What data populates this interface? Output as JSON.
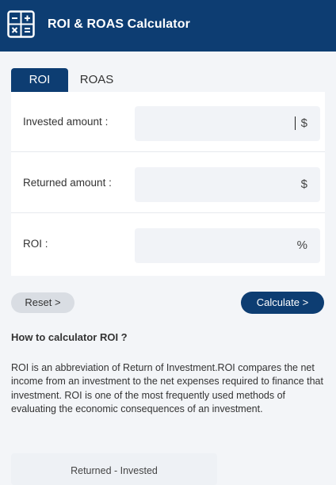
{
  "header": {
    "title": "ROI & ROAS Calculator",
    "logo_icon": "calculator-icon",
    "bg_color": "#0d3d72"
  },
  "tabs": [
    {
      "label": "ROI",
      "active": true
    },
    {
      "label": "ROAS",
      "active": false
    }
  ],
  "form": {
    "rows": [
      {
        "label": "Invested amount :",
        "value": "",
        "unit": "$",
        "focused": true
      },
      {
        "label": "Returned amount :",
        "value": "",
        "unit": "$",
        "focused": false
      },
      {
        "label": "ROI :",
        "value": "",
        "unit": "%",
        "focused": false
      }
    ]
  },
  "buttons": {
    "reset": "Reset >",
    "calculate": "Calculate >"
  },
  "info": {
    "heading": "How to calculator ROI ?",
    "body": "ROI is an abbreviation of Return of Investment.ROI compares the net income from an investment to the net expenses required to finance that investment. ROI is one of the most frequently used methods of evaluating the economic consequences of an investment.",
    "formula": "Returned - Invested"
  }
}
